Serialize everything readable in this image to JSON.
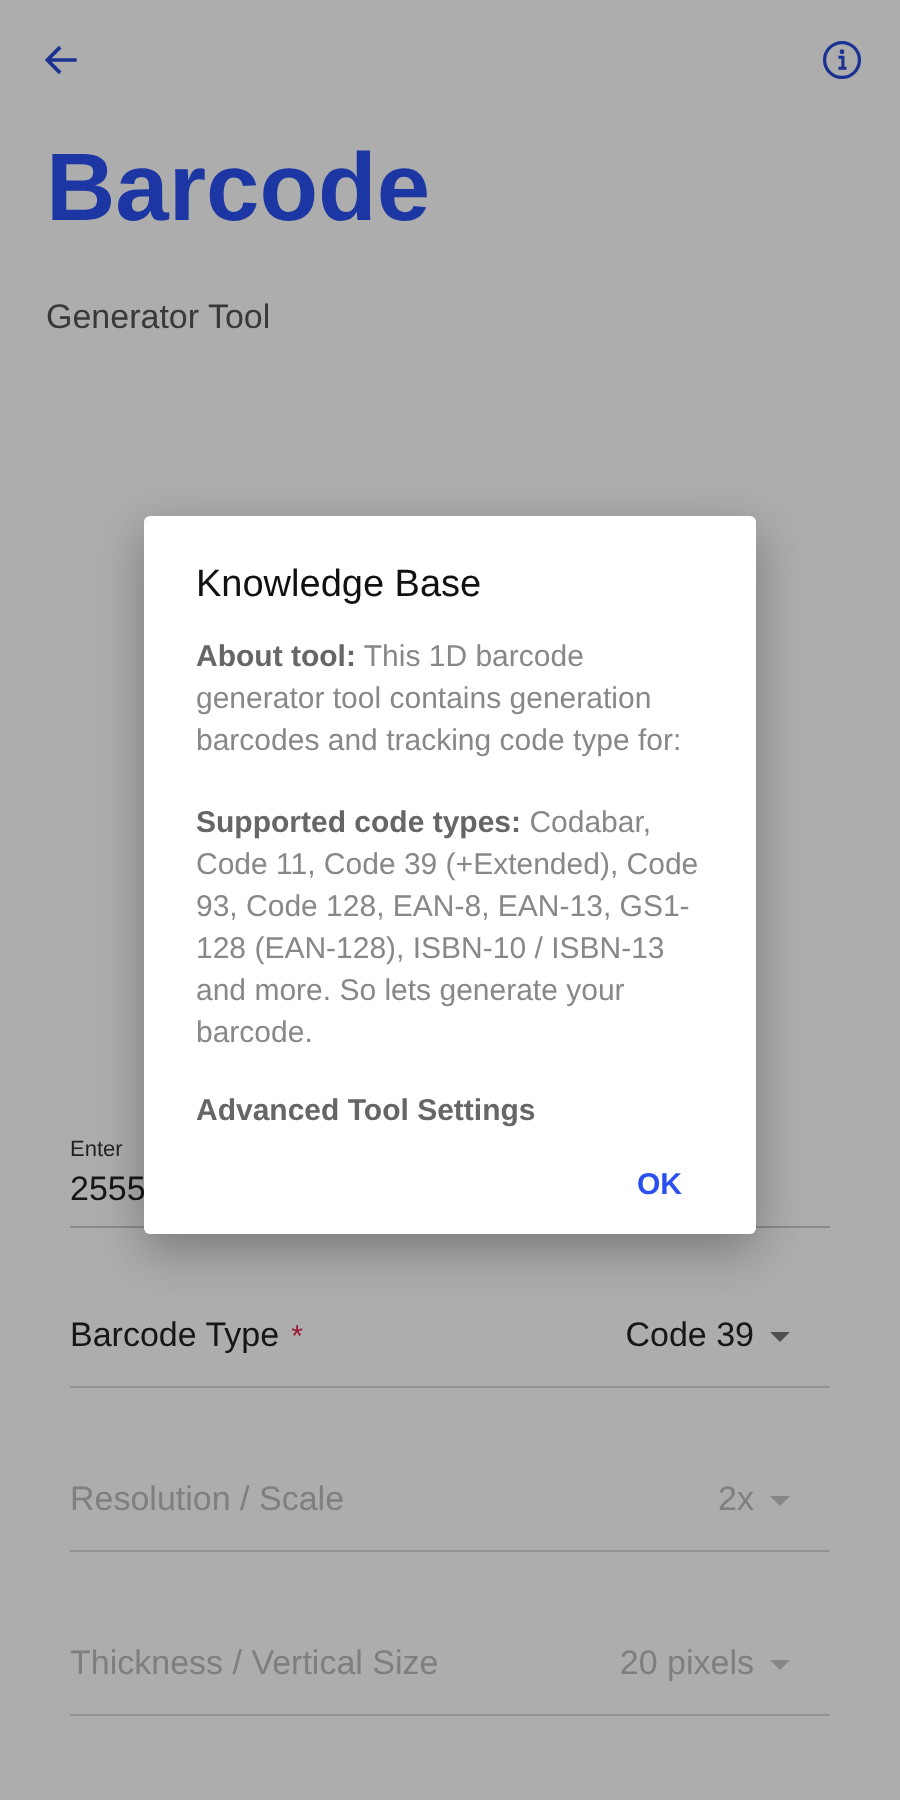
{
  "title": "Barcode",
  "subtitle": "Generator Tool",
  "data_field": {
    "label": "Enter",
    "value": "2555"
  },
  "settings": [
    {
      "label": "Barcode Type",
      "required_mark": "*",
      "value": "Code 39",
      "disabled": false
    },
    {
      "label": "Resolution / Scale",
      "value": "2x",
      "disabled": true
    },
    {
      "label": "Thickness / Vertical Size",
      "value": "20 pixels",
      "disabled": true
    }
  ],
  "dialog": {
    "title": "Knowledge Base",
    "body": [
      {
        "kind": "text",
        "text": "**About tool:** This 1D barcode generator tool contains generation barcodes and tracking code type for:"
      },
      {
        "kind": "text",
        "text": "**Supported code types:** Codabar, Code 11, Code 39 (+Extended), Code 93, Code 128, EAN-8, EAN-13, GS1-128 (EAN-128), ISBN-10 / ISBN-13 and more. So lets generate your barcode."
      },
      {
        "kind": "heading",
        "text": "Advanced Tool Settings"
      }
    ],
    "button": "OK"
  }
}
